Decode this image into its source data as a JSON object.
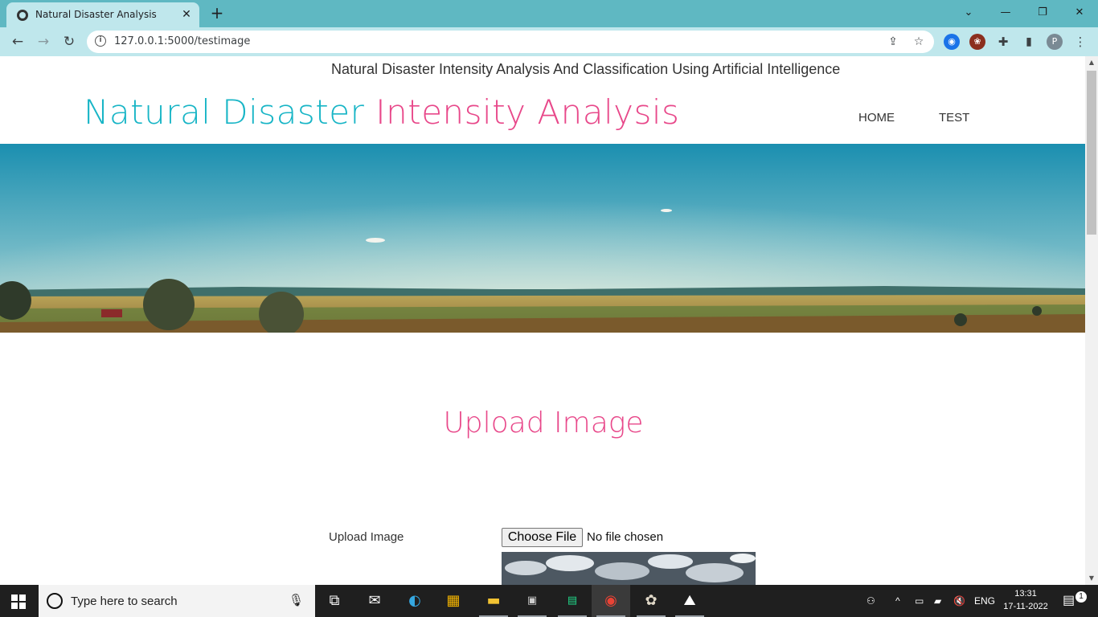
{
  "browser": {
    "tab_title": "Natural Disaster Analysis",
    "url": "127.0.0.1:5000/testimage",
    "profile_initial": "P"
  },
  "page": {
    "top_heading": "Natural Disaster Intensity Analysis And Classification Using Artificial Intelligence",
    "brand_part1": "Natural Disaster",
    "brand_part2": "Intensity Analysis",
    "nav": {
      "home": "HOME",
      "test": "TEST"
    },
    "section_title": "Upload Image",
    "form": {
      "upload_label": "Upload Image",
      "choose_file": "Choose File",
      "no_file": "No file chosen"
    }
  },
  "colors": {
    "teal": "#18b5c6",
    "pink": "#e8488a",
    "chrome_top": "#5fb8c2",
    "chrome_toolbar": "#bfe7ec"
  },
  "taskbar": {
    "search_placeholder": "Type here to search",
    "language": "ENG",
    "time": "13:31",
    "date": "17-11-2022",
    "notification_count": "1"
  }
}
